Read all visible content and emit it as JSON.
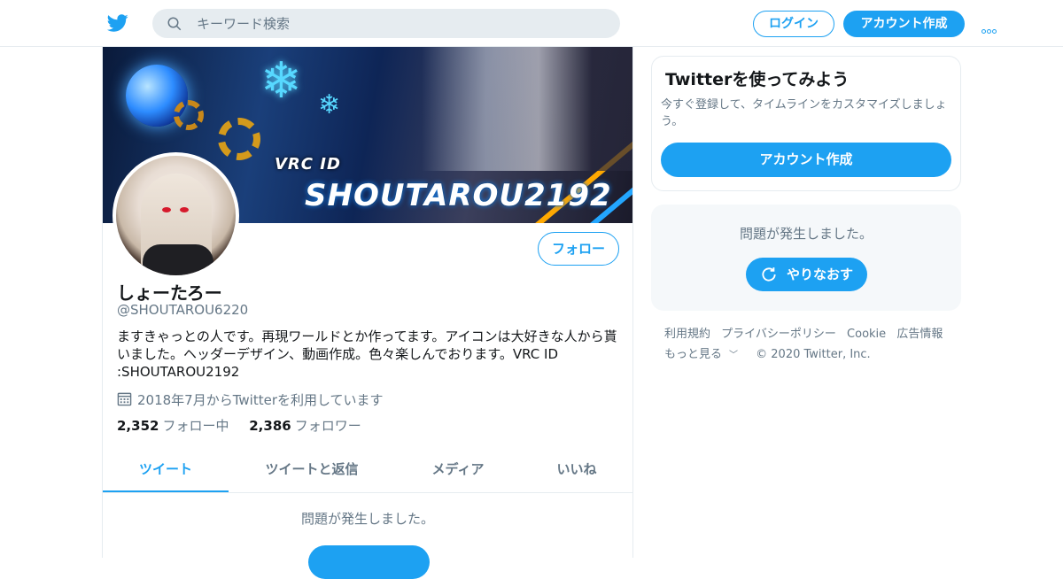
{
  "header": {
    "search_placeholder": "キーワード検索",
    "login_label": "ログイン",
    "signup_label": "アカウント作成"
  },
  "profile": {
    "banner_title_small": "VRC ID",
    "banner_title_big": "SHOUTAROU2192",
    "follow_label": "フォロー",
    "name": "しょーたろー",
    "handle": "@SHOUTAROU6220",
    "bio": "ますきゃっとの人です。再現ワールドとか作ってます。アイコンは大好きな人から貰いました。ヘッダーデザイン、動画作成。色々楽しんでおります。VRC ID :SHOUTAROU2192",
    "joined": "2018年7月からTwitterを利用しています",
    "following_count": "2,352",
    "following_label": "フォロー中",
    "followers_count": "2,386",
    "followers_label": "フォロワー"
  },
  "tabs": [
    {
      "label": "ツイート"
    },
    {
      "label": "ツイートと返信"
    },
    {
      "label": "メディア"
    },
    {
      "label": "いいね"
    }
  ],
  "timeline": {
    "error": "問題が発生しました。"
  },
  "sidebar": {
    "card_title": "Twitterを使ってみよう",
    "card_text": "今すぐ登録して、タイムラインをカスタマイズしましょう。",
    "card_cta": "アカウント作成",
    "error_message": "問題が発生しました。",
    "retry_label": "やりなおす"
  },
  "footer": {
    "links": [
      "利用規約",
      "プライバシーポリシー",
      "Cookie",
      "広告情報"
    ],
    "more": "もっと見る",
    "copyright": "© 2020 Twitter, Inc."
  },
  "colors": {
    "accent": "#1da1f2",
    "secondary_text": "#657786",
    "border": "#e6ecf0"
  }
}
